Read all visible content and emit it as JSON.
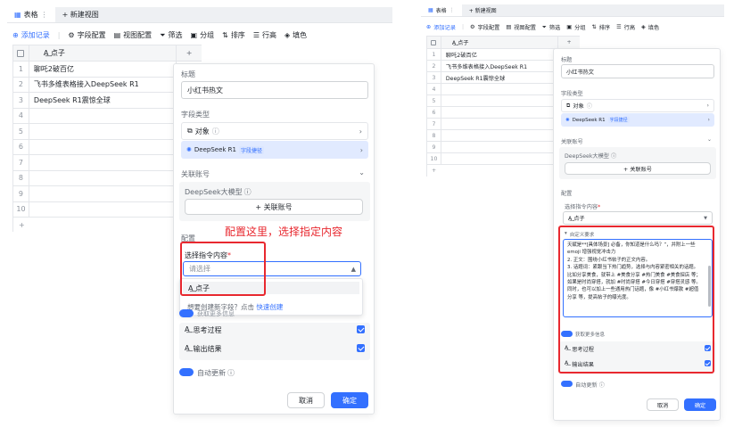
{
  "left": {
    "tabs": {
      "table": "表格",
      "table_more": "⋮",
      "add_view": "+ 新建视图"
    },
    "toolbar": {
      "add_record": "添加记录",
      "field_config": "字段配置",
      "view_config": "视图配置",
      "filter": "筛选",
      "group": "分组",
      "sort": "排序",
      "row_height": "行高",
      "fill": "填色"
    },
    "grid": {
      "col_header": "A͟ 点子",
      "add_col": "+",
      "rows": [
        "1",
        "2",
        "3",
        "4",
        "5",
        "6",
        "7",
        "8",
        "9",
        "10"
      ],
      "values": [
        "聊吒2破百亿",
        "飞书多维表格接入DeepSeek R1",
        "DeepSeek R1震惊全球"
      ],
      "add_row": "+"
    },
    "panel": {
      "title_label": "标题",
      "title_value": "小红书热文",
      "field_type_label": "字段类型",
      "type_object": "对象",
      "type_deepseek": "DeepSeek R1",
      "type_badge": "字段捷径",
      "account_label": "关联账号",
      "account_name": "DeepSeek大模型",
      "add_account": "+ 关联账号",
      "config_label": "配置",
      "select_label": "选择指令内容",
      "required": "*",
      "placeholder": "请选择",
      "option": "A͟ 点子",
      "create_hint": "想要创建新字段？点击",
      "create_link": "快速创建",
      "more_info": "获取更多信息",
      "think": "思考过程",
      "output": "输出结果",
      "auto_update": "自动更新",
      "cancel": "取消",
      "ok": "确定"
    },
    "annotation": "配置这里，选择指定内容"
  },
  "right": {
    "tabs": {
      "table": "表格",
      "table_more": "⋮",
      "add_view": "+ 新建视图"
    },
    "toolbar": {
      "add_record": "添加记录",
      "field_config": "字段配置",
      "view_config": "视图配置",
      "filter": "筛选",
      "group": "分组",
      "sort": "排序",
      "row_height": "行高",
      "fill": "填色"
    },
    "grid": {
      "col_header": "A͟ 点子",
      "add_col": "+",
      "rows": [
        "1",
        "2",
        "3",
        "4",
        "5",
        "6",
        "7",
        "8",
        "9",
        "10"
      ],
      "values": [
        "聊吒2破百亿",
        "飞书多维表格接入DeepSeek R1",
        "DeepSeek R1震惊全球"
      ],
      "add_row": "+"
    },
    "panel": {
      "title_label": "标题",
      "title_value": "小红书热文",
      "field_type_label": "字段类型",
      "type_object": "对象",
      "type_deepseek": "DeepSeek R1",
      "type_badge": "字段捷径",
      "account_label": "关联账号",
      "account_name": "DeepSeek大模型",
      "add_account": "+ 关联账号",
      "config_label": "配置",
      "select_label": "选择指令内容",
      "required": "*",
      "select_value": "A͟ 点子",
      "custom_req": "自定义要求",
      "prompt_text": "天赋是**[具体场景] 必备，你知道是什么吗？”，并附上一些 emoji 增强视觉冲击力\n2. 正文：围绕小红书帖子的正文内容。\n3. 话题词：紧跟当下热门趋势，选择与内容紧密相关的话题。比如分享美食，就带上 #美食分享 #热门美食 #美食探店 等；如果是时尚穿搭，就加 #时尚穿搭 #今日穿搭 #穿搭灵感 等。同时，也可以加上一些通用热门话题，像 #小红书爆款 #超值分享 等，提高帖子的曝光度。",
      "more_info": "获取更多信息",
      "think": "思考过程",
      "output": "输出结果",
      "auto_update": "自动更新",
      "cancel": "取消",
      "ok": "确定"
    }
  }
}
